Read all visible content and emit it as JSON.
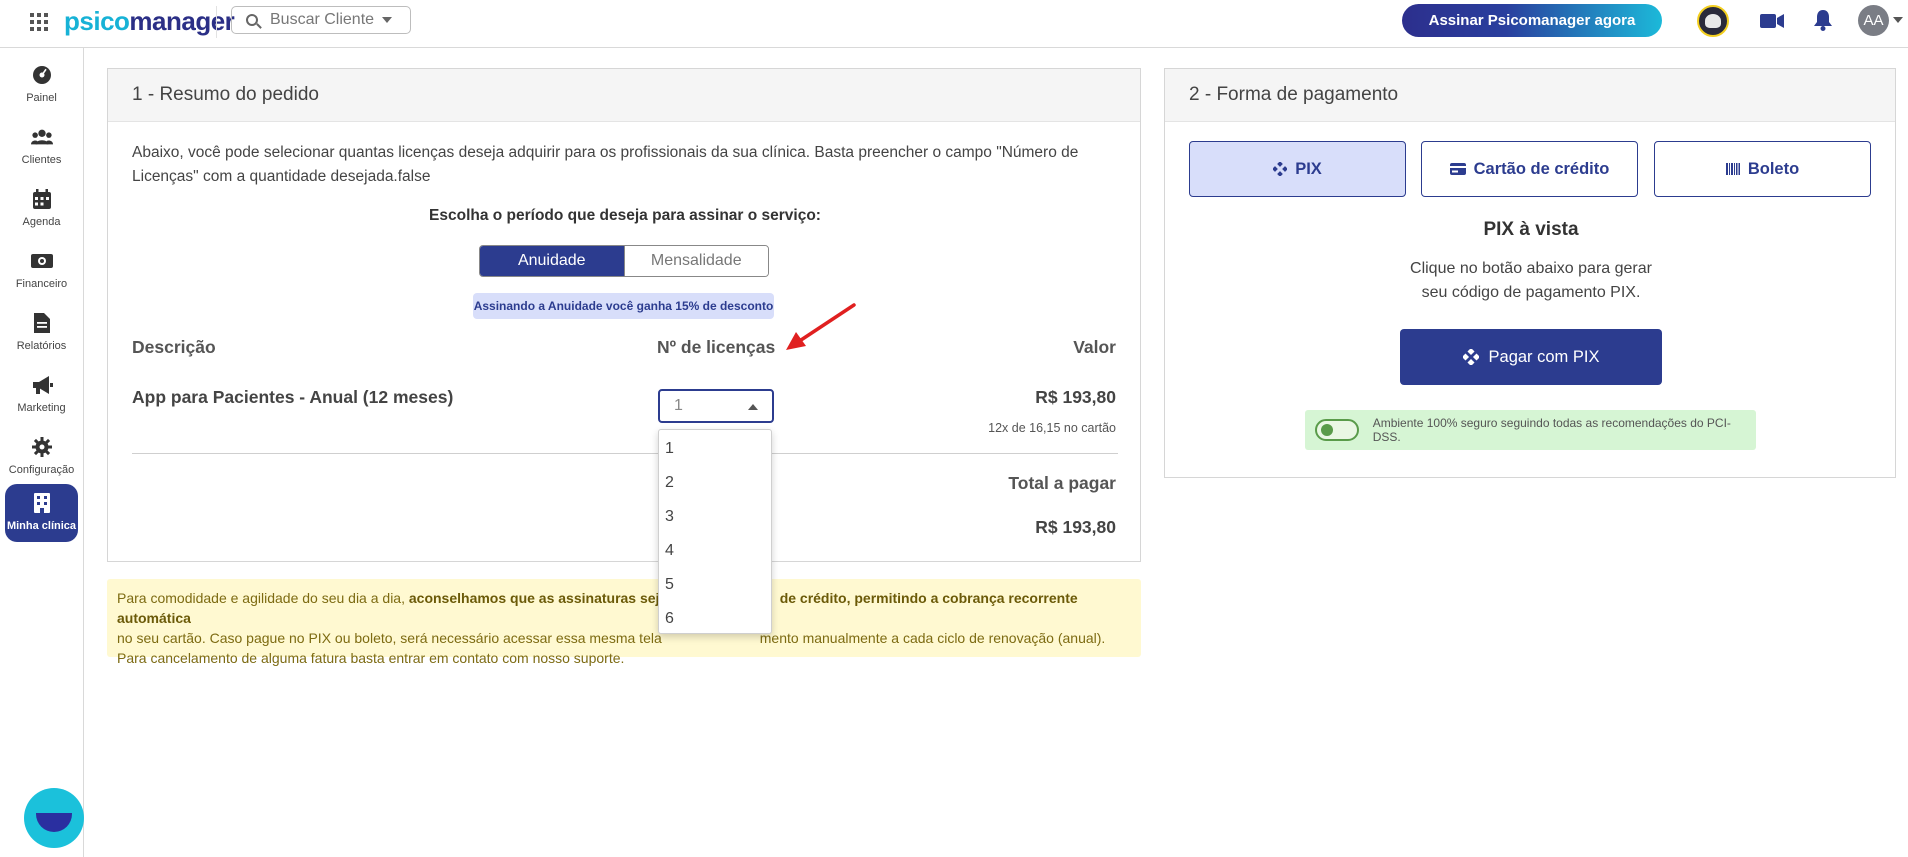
{
  "app": {
    "logo_part1": "psico",
    "logo_part2": "manager",
    "search_placeholder": "Buscar Cliente",
    "subscribe_label": "Assinar Psicomanager agora",
    "user_initials": "AA"
  },
  "sidebar": {
    "items": [
      {
        "label": "Painel",
        "icon": "dashboard-icon"
      },
      {
        "label": "Clientes",
        "icon": "users-icon"
      },
      {
        "label": "Agenda",
        "icon": "calendar-icon"
      },
      {
        "label": "Financeiro",
        "icon": "money-icon"
      },
      {
        "label": "Relatórios",
        "icon": "report-icon"
      },
      {
        "label": "Marketing",
        "icon": "megaphone-icon"
      },
      {
        "label": "Configuração",
        "icon": "gear-icon"
      },
      {
        "label": "Minha clínica",
        "icon": "building-icon"
      }
    ],
    "active_index": 7
  },
  "order": {
    "title": "1 - Resumo do pedido",
    "intro": "Abaixo, você pode selecionar quantas licenças deseja adquirir para os profissionais da sua clínica. Basta preencher o campo \"Número de Licenças\" com a quantidade desejada.false",
    "period_question": "Escolha o período que deseja para assinar o serviço:",
    "period_options": [
      "Anuidade",
      "Mensalidade"
    ],
    "period_selected": "Anuidade",
    "discount_note": "Assinando a Anuidade você ganha 15% de desconto",
    "col_description": "Descrição",
    "col_licenses": "Nº de licenças",
    "col_value": "Valor",
    "item_description": "App para Pacientes - Anual (12 meses)",
    "licenses_value": "1",
    "license_options": [
      "1",
      "2",
      "3",
      "4",
      "5",
      "6"
    ],
    "item_price": "R$ 193,80",
    "installments": "12x de 16,15 no cartão",
    "total_label": "Total a pagar",
    "total_value": "R$ 193,80"
  },
  "notice": {
    "part1": "Para comodidade e agilidade do seu dia a dia, ",
    "bold1": "aconselhamos que as assinaturas sejam",
    "bold2": "de crédito, permitindo a cobrança recorrente automática",
    "line2a": "no seu cartão. Caso pague no PIX ou boleto, será necessário acessar essa mesma tela",
    "line2b": "mento manualmente a cada ciclo de renovação (anual).",
    "line3": "Para cancelamento de alguma fatura basta entrar em contato com nosso suporte."
  },
  "payment": {
    "title": "2 - Forma de pagamento",
    "methods": [
      "PIX",
      "Cartão de crédito",
      "Boleto"
    ],
    "selected": "PIX",
    "pix_title": "PIX à vista",
    "pix_desc_line1": "Clique no botão abaixo para gerar",
    "pix_desc_line2": "seu código de pagamento PIX.",
    "pix_button": "Pagar com PIX",
    "secure_note": "Ambiente 100% seguro seguindo todas as recomendações do PCI-DSS."
  },
  "colors": {
    "primary": "#2c3c8f",
    "brand_cyan": "#17b2d6",
    "selected_bg": "#d8defa",
    "annotation_arrow": "#e02020"
  }
}
